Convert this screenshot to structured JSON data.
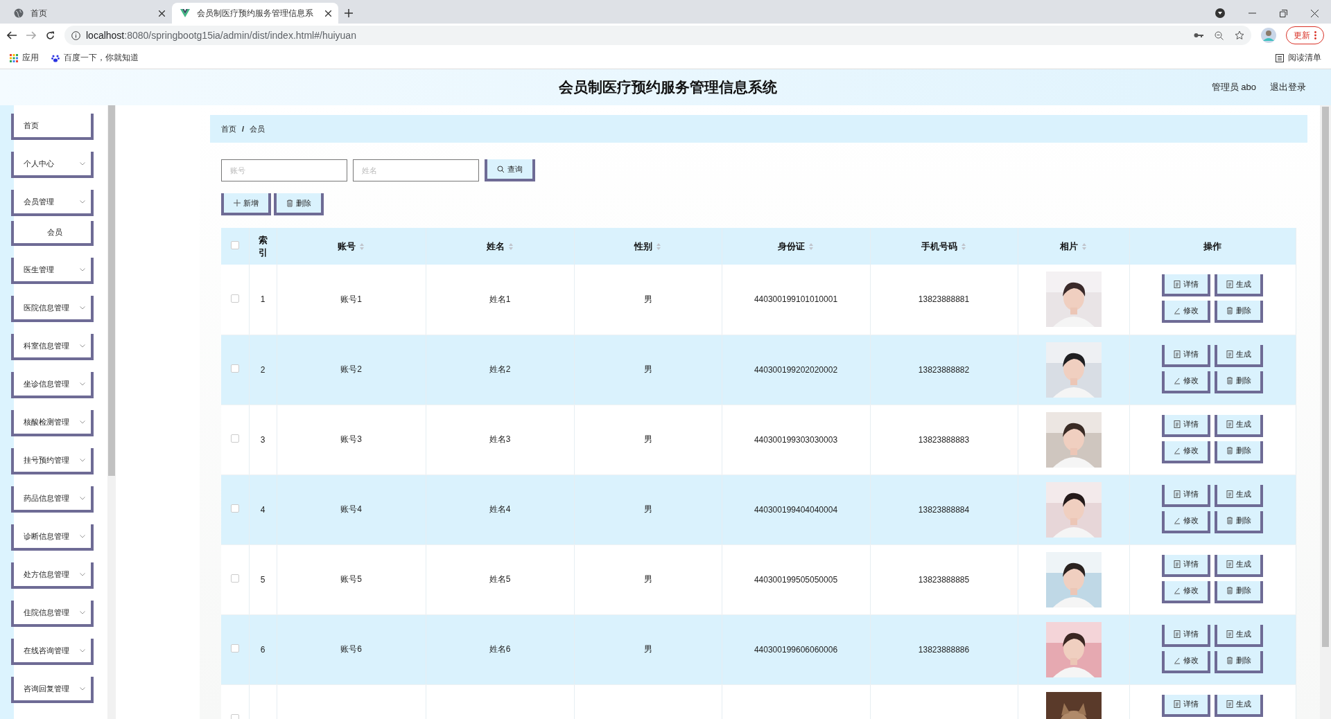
{
  "browser": {
    "tabs": [
      {
        "title": "首页",
        "selected": false
      },
      {
        "title": "会员制医疗预约服务管理信息系",
        "selected": true
      }
    ],
    "url_host": "localhost",
    "url_rest": ":8080/springbootg15ia/admin/dist/index.html#/huiyuan",
    "update_button": "更新",
    "bookmarks": [
      "应用",
      "百度一下，你就知道"
    ],
    "reading_list": "阅读清单"
  },
  "app": {
    "title": "会员制医疗预约服务管理信息系统",
    "user": "管理员 abo",
    "logout": "退出登录"
  },
  "sidebar": {
    "items": [
      {
        "label": "首页",
        "kind": "link"
      },
      {
        "label": "个人中心",
        "kind": "menu"
      },
      {
        "label": "会员管理",
        "kind": "menu"
      },
      {
        "label": "会员",
        "kind": "sub"
      },
      {
        "label": "医生管理",
        "kind": "menu"
      },
      {
        "label": "医院信息管理",
        "kind": "menu"
      },
      {
        "label": "科室信息管理",
        "kind": "menu"
      },
      {
        "label": "坐诊信息管理",
        "kind": "menu"
      },
      {
        "label": "核酸检测管理",
        "kind": "menu"
      },
      {
        "label": "挂号预约管理",
        "kind": "menu"
      },
      {
        "label": "药品信息管理",
        "kind": "menu"
      },
      {
        "label": "诊断信息管理",
        "kind": "menu"
      },
      {
        "label": "处方信息管理",
        "kind": "menu"
      },
      {
        "label": "住院信息管理",
        "kind": "menu"
      },
      {
        "label": "在线咨询管理",
        "kind": "menu"
      },
      {
        "label": "咨询回复管理",
        "kind": "menu"
      }
    ]
  },
  "breadcrumb": {
    "items": [
      "首页",
      "会员"
    ],
    "separator": "/"
  },
  "search": {
    "fields": [
      {
        "placeholder": "账号"
      },
      {
        "placeholder": "姓名"
      }
    ],
    "button": "查询"
  },
  "actions": [
    {
      "label": "新增",
      "kind": "add"
    },
    {
      "label": "删除",
      "kind": "delete"
    }
  ],
  "table": {
    "select_all_checked": false,
    "columns": [
      {
        "label": "索引",
        "sortable": false
      },
      {
        "label": "账号",
        "sortable": true
      },
      {
        "label": "姓名",
        "sortable": true
      },
      {
        "label": "性别",
        "sortable": true
      },
      {
        "label": "身份证",
        "sortable": true
      },
      {
        "label": "手机号码",
        "sortable": true
      },
      {
        "label": "相片",
        "sortable": true
      },
      {
        "label": "操作",
        "sortable": false
      }
    ],
    "rows": [
      {
        "checked": false,
        "cells": [
          "1",
          "账号1",
          "姓名1",
          "男",
          "440300199101010001",
          "13823888881"
        ],
        "photo": {
          "kind": "picture"
        },
        "actions": [
          {
            "label": "详情",
            "kind": "detail"
          },
          {
            "label": "生成",
            "kind": "detail"
          },
          {
            "label": "修改",
            "kind": "edit"
          },
          {
            "label": "删除",
            "kind": "delete"
          }
        ]
      },
      {
        "checked": false,
        "cells": [
          "2",
          "账号2",
          "姓名2",
          "男",
          "440300199202020002",
          "13823888882"
        ],
        "photo": {
          "kind": "picture"
        },
        "actions": [
          {
            "label": "详情",
            "kind": "detail"
          },
          {
            "label": "生成",
            "kind": "detail"
          },
          {
            "label": "修改",
            "kind": "edit"
          },
          {
            "label": "删除",
            "kind": "delete"
          }
        ]
      },
      {
        "checked": false,
        "cells": [
          "3",
          "账号3",
          "姓名3",
          "男",
          "440300199303030003",
          "13823888883"
        ],
        "photo": {
          "kind": "picture"
        },
        "actions": [
          {
            "label": "详情",
            "kind": "detail"
          },
          {
            "label": "生成",
            "kind": "detail"
          },
          {
            "label": "修改",
            "kind": "edit"
          },
          {
            "label": "删除",
            "kind": "delete"
          }
        ]
      },
      {
        "checked": false,
        "cells": [
          "4",
          "账号4",
          "姓名4",
          "男",
          "440300199404040004",
          "13823888884"
        ],
        "photo": {
          "kind": "picture"
        },
        "actions": [
          {
            "label": "详情",
            "kind": "detail"
          },
          {
            "label": "生成",
            "kind": "detail"
          },
          {
            "label": "修改",
            "kind": "edit"
          },
          {
            "label": "删除",
            "kind": "delete"
          }
        ]
      },
      {
        "checked": false,
        "cells": [
          "5",
          "账号5",
          "姓名5",
          "男",
          "440300199505050005",
          "13823888885"
        ],
        "photo": {
          "kind": "picture"
        },
        "actions": [
          {
            "label": "详情",
            "kind": "detail"
          },
          {
            "label": "生成",
            "kind": "detail"
          },
          {
            "label": "修改",
            "kind": "edit"
          },
          {
            "label": "删除",
            "kind": "delete"
          }
        ]
      },
      {
        "checked": false,
        "cells": [
          "6",
          "账号6",
          "姓名6",
          "男",
          "440300199606060006",
          "13823888886"
        ],
        "photo": {
          "kind": "picture"
        },
        "actions": [
          {
            "label": "详情",
            "kind": "detail"
          },
          {
            "label": "生成",
            "kind": "detail"
          },
          {
            "label": "修改",
            "kind": "edit"
          },
          {
            "label": "删除",
            "kind": "delete"
          }
        ]
      },
      {
        "checked": false,
        "cells": [],
        "photo": {
          "kind": "picture"
        },
        "actions": [
          {
            "label": "详情",
            "kind": "detail"
          },
          {
            "label": "生成",
            "kind": "detail"
          }
        ]
      }
    ]
  }
}
